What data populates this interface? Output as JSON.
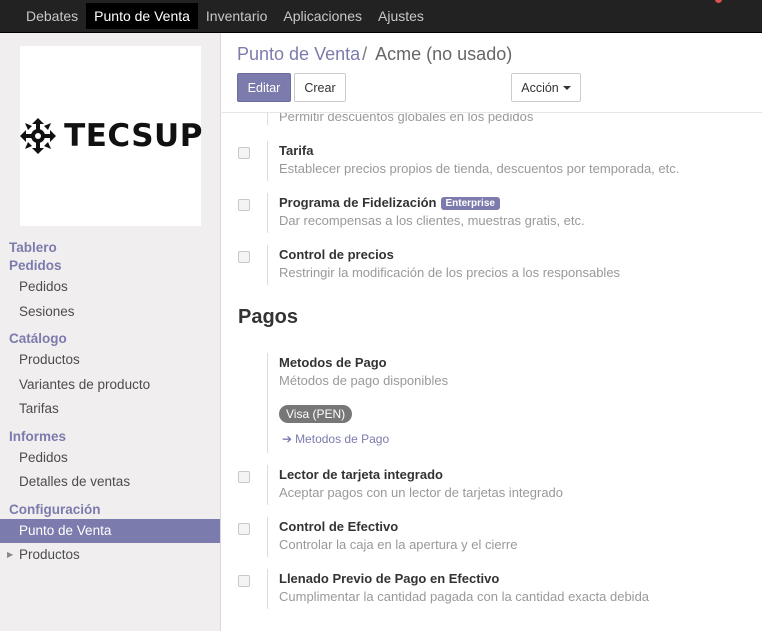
{
  "topbar": {
    "items": [
      "Debates",
      "Punto de Venta",
      "Inventario",
      "Aplicaciones",
      "Ajustes"
    ],
    "active_index": 1
  },
  "logo": {
    "text": "TECSUP"
  },
  "sidebar": {
    "tablero": "Tablero",
    "pedidos_head": "Pedidos",
    "pedidos": "Pedidos",
    "sesiones": "Sesiones",
    "catalogo_head": "Catálogo",
    "productos": "Productos",
    "variantes": "Variantes de producto",
    "tarifas": "Tarifas",
    "informes_head": "Informes",
    "informes_pedidos": "Pedidos",
    "detalles": "Detalles de ventas",
    "config_head": "Configuración",
    "punto_venta": "Punto de Venta",
    "config_productos": "Productos"
  },
  "breadcrumb": {
    "parent": "Punto de Venta",
    "separator": "/",
    "current": "Acme (no usado)"
  },
  "buttons": {
    "edit": "Editar",
    "create": "Crear",
    "action": "Acción"
  },
  "settings": {
    "cut_desc": "Permitir descuentos globales en los pedidos",
    "tarifa_title": "Tarifa",
    "tarifa_desc": "Establecer precios propios de tienda, descuentos por temporada, etc.",
    "fidel_title": "Programa de Fidelización",
    "fidel_badge": "Enterprise",
    "fidel_desc": "Dar recompensas a los clientes, muestras gratis, etc.",
    "control_title": "Control de precios",
    "control_desc": "Restringir la modificación de los precios a los responsables",
    "section_pagos": "Pagos",
    "metodos_title": "Metodos de Pago",
    "metodos_desc": "Métodos de pago disponibles",
    "metodos_tag": "Visa (PEN)",
    "metodos_link": "Metodos de Pago",
    "lector_title": "Lector de tarjeta integrado",
    "lector_desc": "Aceptar pagos con un lector de tarjetas integrado",
    "efectivo_title": "Control de Efectivo",
    "efectivo_desc": "Controlar la caja en la apertura y el cierre",
    "llenado_title": "Llenado Previo de Pago en Efectivo",
    "llenado_desc": "Cumplimentar la cantidad pagada con la cantidad exacta debida"
  },
  "colors": {
    "accent": "#7c7bad",
    "topbar": "#222222"
  }
}
